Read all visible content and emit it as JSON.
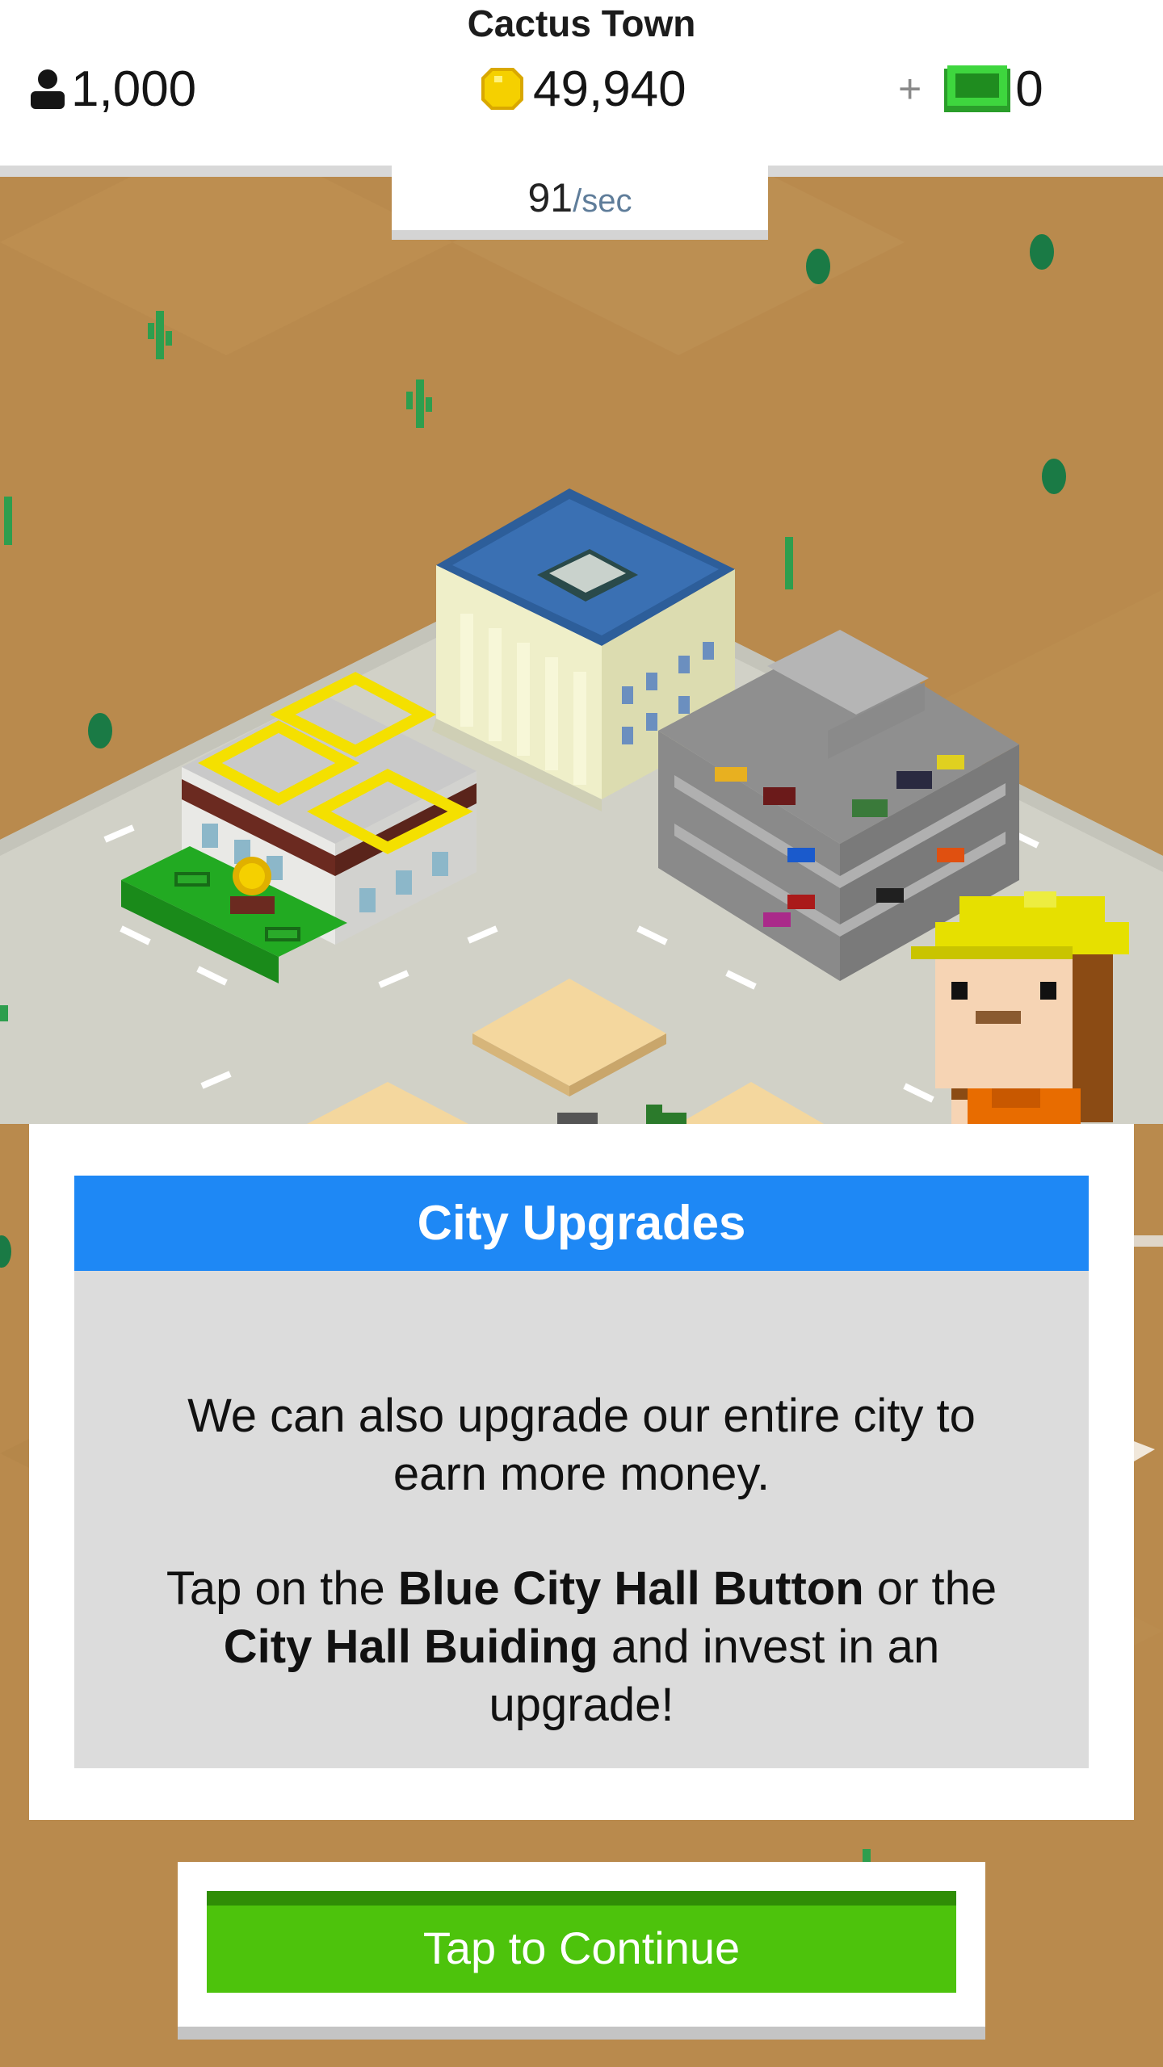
{
  "header": {
    "town_name": "Cactus Town",
    "population": "1,000",
    "coins": "49,940",
    "cash_plus": "+",
    "cash": "0",
    "income_rate": "91",
    "income_unit": "/sec"
  },
  "dialog": {
    "title": "City Upgrades",
    "paragraph1": "We can also upgrade our entire city to earn more money.",
    "p2_part1": "Tap on the ",
    "p2_bold1": "Blue City Hall Button",
    "p2_part2": " or the ",
    "p2_bold2": "City Hall Buiding",
    "p2_part3": " and invest in an upgrade!"
  },
  "continue_button": {
    "label": "Tap to Continue"
  },
  "icons": [
    "person-icon",
    "coin-icon",
    "plus-icon",
    "cash-icon"
  ],
  "colors": {
    "accent_blue": "#1e88f5",
    "continue_green": "#4dc30c",
    "desert": "#b98a4d",
    "coin_yellow": "#f5d000"
  }
}
